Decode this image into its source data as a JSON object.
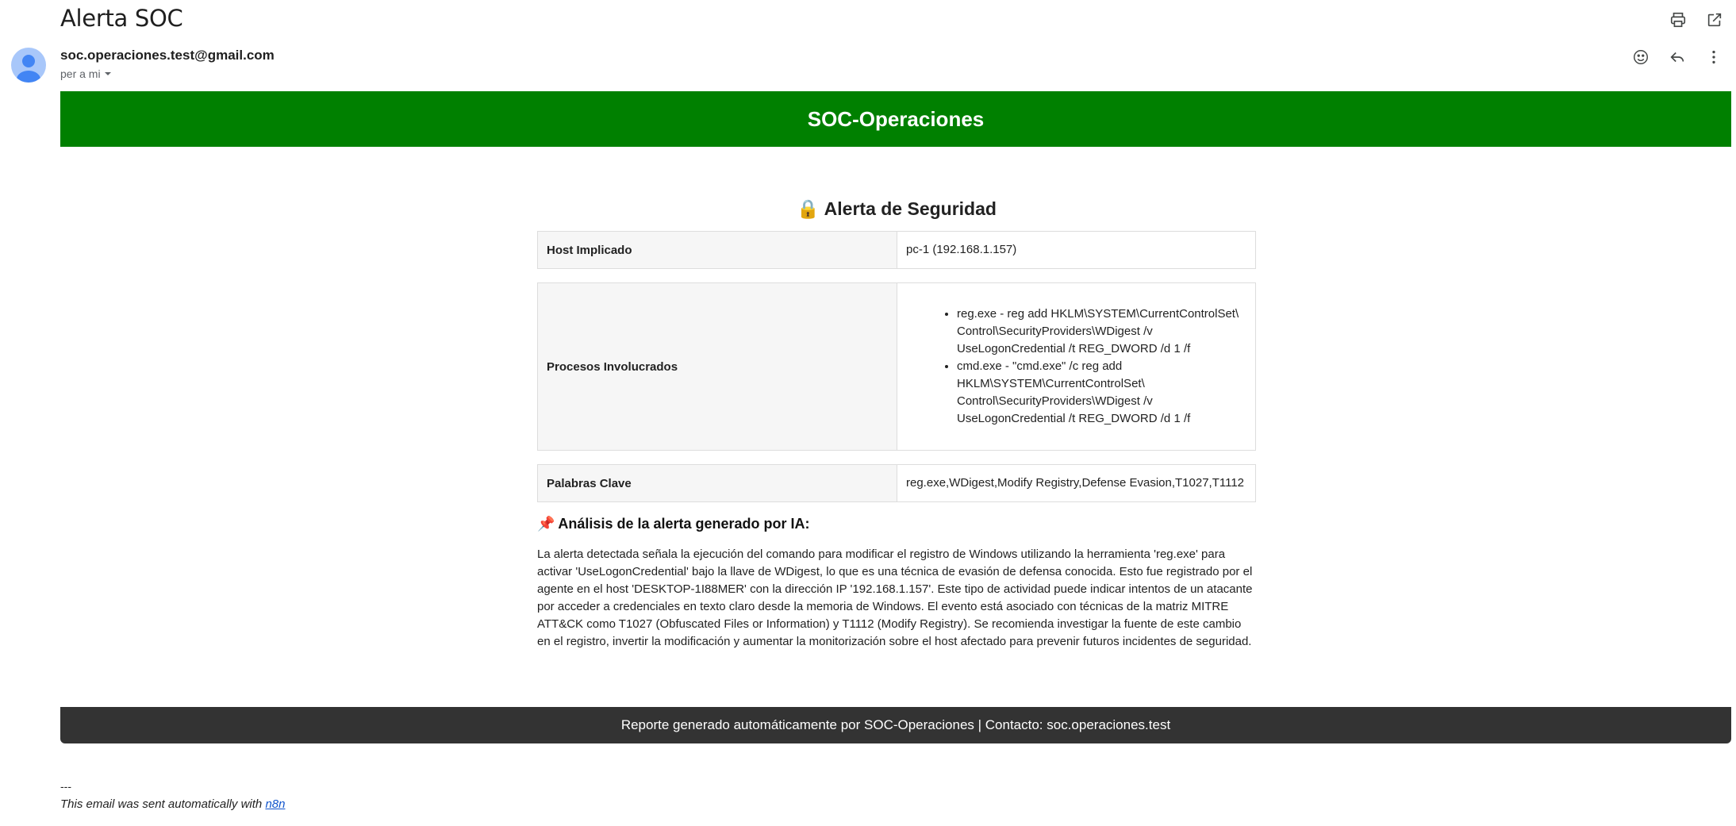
{
  "email": {
    "subject": "Alerta SOC",
    "sender": "soc.operaciones.test@gmail.com",
    "recipient_label": "per a mi",
    "icons": [
      "print-icon",
      "open-in-new-window-icon",
      "emoji-icon",
      "reply-icon",
      "more-vert-icon",
      "avatar"
    ]
  },
  "banner": {
    "title": "SOC-Operaciones",
    "color": "#008000"
  },
  "alert": {
    "title": "Alerta de Seguridad",
    "lock_emoji": "🔒",
    "host_label": "Host Implicado",
    "host_value": "pc-1 (192.168.1.157)",
    "processes_label": "Procesos Involucrados",
    "processes": [
      "reg.exe - reg add HKLM\\SYSTEM\\CurrentControlSet\\ Control\\SecurityProviders\\WDigest /v UseLogonCredential /t REG_DWORD /d 1 /f",
      "cmd.exe - \"cmd.exe\" /c reg add HKLM\\SYSTEM\\CurrentControlSet\\ Control\\SecurityProviders\\WDigest /v UseLogonCredential /t REG_DWORD /d 1 /f"
    ],
    "keywords_label": "Palabras Clave",
    "keywords_value": "reg.exe,WDigest,Modify Registry,Defense Evasion,T1027,T1112"
  },
  "analysis": {
    "pin_emoji": "📌",
    "title": "Análisis de la alerta generado por IA:",
    "text": "La alerta detectada señala la ejecución del comando para modificar el registro de Windows utilizando la herramienta 'reg.exe' para activar 'UseLogonCredential' bajo la llave de WDigest, lo que es una técnica de evasión de defensa conocida. Esto fue registrado por el agente en el host 'DESKTOP-1I88MER' con la dirección IP '192.168.1.157'. Este tipo de actividad puede indicar intentos de un atacante por acceder a credenciales en texto claro desde la memoria de Windows. El evento está asociado con técnicas de la matriz MITRE ATT&CK como T1027 (Obfuscated Files or Information) y T1112 (Modify Registry). Se recomienda investigar la fuente de este cambio en el registro, invertir la modificación y aumentar la monitorización sobre el host afectado para prevenir futuros incidentes de seguridad."
  },
  "footer": {
    "text": "Reporte generado automáticamente por SOC-Operaciones | Contacto: soc.operaciones.test",
    "color": "#333333"
  },
  "signature": {
    "dashes": "---",
    "text": "This email was sent automatically with ",
    "link": "n8n"
  }
}
